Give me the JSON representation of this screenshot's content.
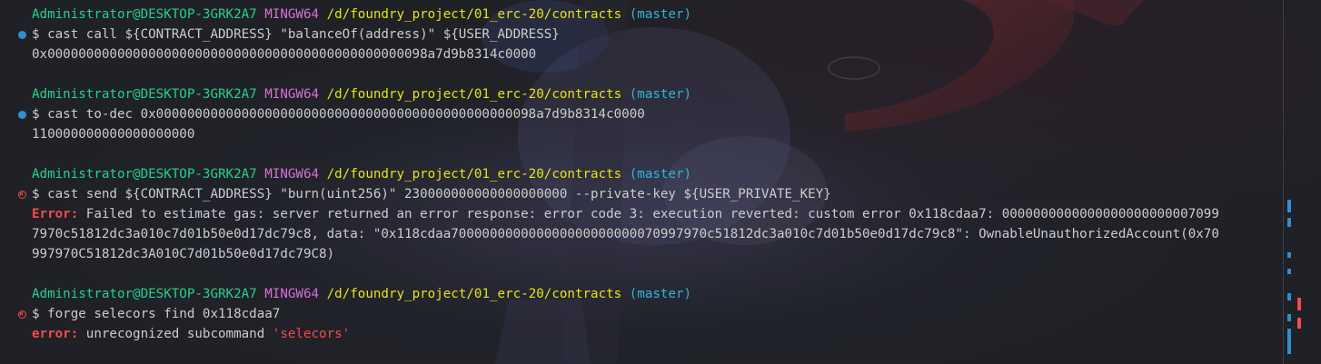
{
  "prompt": {
    "user": "Administrator@DESKTOP-3GRK2A7",
    "env": "MINGW64",
    "path": "/d/foundry_project/01_erc-20/contracts",
    "branch": "(master)"
  },
  "blocks": [
    {
      "status": "success",
      "command": "$ cast call ${CONTRACT_ADDRESS} \"balanceOf(address)\" ${USER_ADDRESS}",
      "output": [
        "0x0000000000000000000000000000000000000000000000098a7d9b8314c0000"
      ]
    },
    {
      "status": "success",
      "command": "$ cast to-dec 0x0000000000000000000000000000000000000000000000098a7d9b8314c0000",
      "output": [
        "110000000000000000000"
      ]
    },
    {
      "status": "error",
      "command": "$ cast send ${CONTRACT_ADDRESS} \"burn(uint256)\" 230000000000000000000 --private-key ${USER_PRIVATE_KEY}",
      "error_label": "Error:",
      "error_lines": [
        " Failed to estimate gas: server returned an error response: error code 3: execution reverted: custom error 0x118cdaa7: 000000000000000000000000070997970c51812dc3a010c7d01b50e0d17dc79c8, data: \"0x118cdaa70000000000000000000000000070997970c51812dc3a010c7d01b50e0d17dc79c8\": OwnableUnauthorizedAccount(0x70997970C51812dc3A010C7d01b50e0d17dc79C8)"
      ],
      "error_wrapped": [
        " Failed to estimate gas: server returned an error response: error code 3: execution reverted: custom error 0x118cdaa7: 0000000000000000000000007099",
        "7970c51812dc3a010c7d01b50e0d17dc79c8, data: \"0x118cdaa700000000000000000000000070997970c51812dc3a010c7d01b50e0d17dc79c8\": OwnableUnauthorizedAccount(0x70",
        "997970C51812dc3A010C7d01b50e0d17dc79C8)"
      ]
    },
    {
      "status": "error",
      "command": "$ forge selecors find 0x118cdaa7",
      "error_label": "error:",
      "error_text": " unrecognized subcommand ",
      "error_quote": "'selecors'"
    }
  ],
  "colors": {
    "user": "#23d18b",
    "env": "#d670d6",
    "path": "#e5e510",
    "branch": "#29b8db",
    "error": "#f14c4c",
    "success_dot": "#2f8fd0"
  }
}
